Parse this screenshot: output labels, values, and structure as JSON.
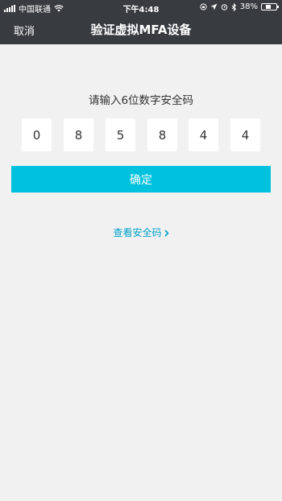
{
  "status_bar": {
    "carrier": "中国联通",
    "time": "下午4:48",
    "battery": "38%",
    "battery_level": 0.38
  },
  "nav": {
    "cancel_label": "取消",
    "title": "验证虚拟MFA设备"
  },
  "form": {
    "prompt": "请输入6位数字安全码",
    "digits": [
      "0",
      "8",
      "5",
      "8",
      "4",
      "4"
    ],
    "confirm_label": "确定",
    "view_code_label": "查看安全码"
  },
  "colors": {
    "header_bg": "#383b40",
    "page_bg": "#f1f1f1",
    "accent": "#00c1de",
    "link": "#00a2ca"
  }
}
